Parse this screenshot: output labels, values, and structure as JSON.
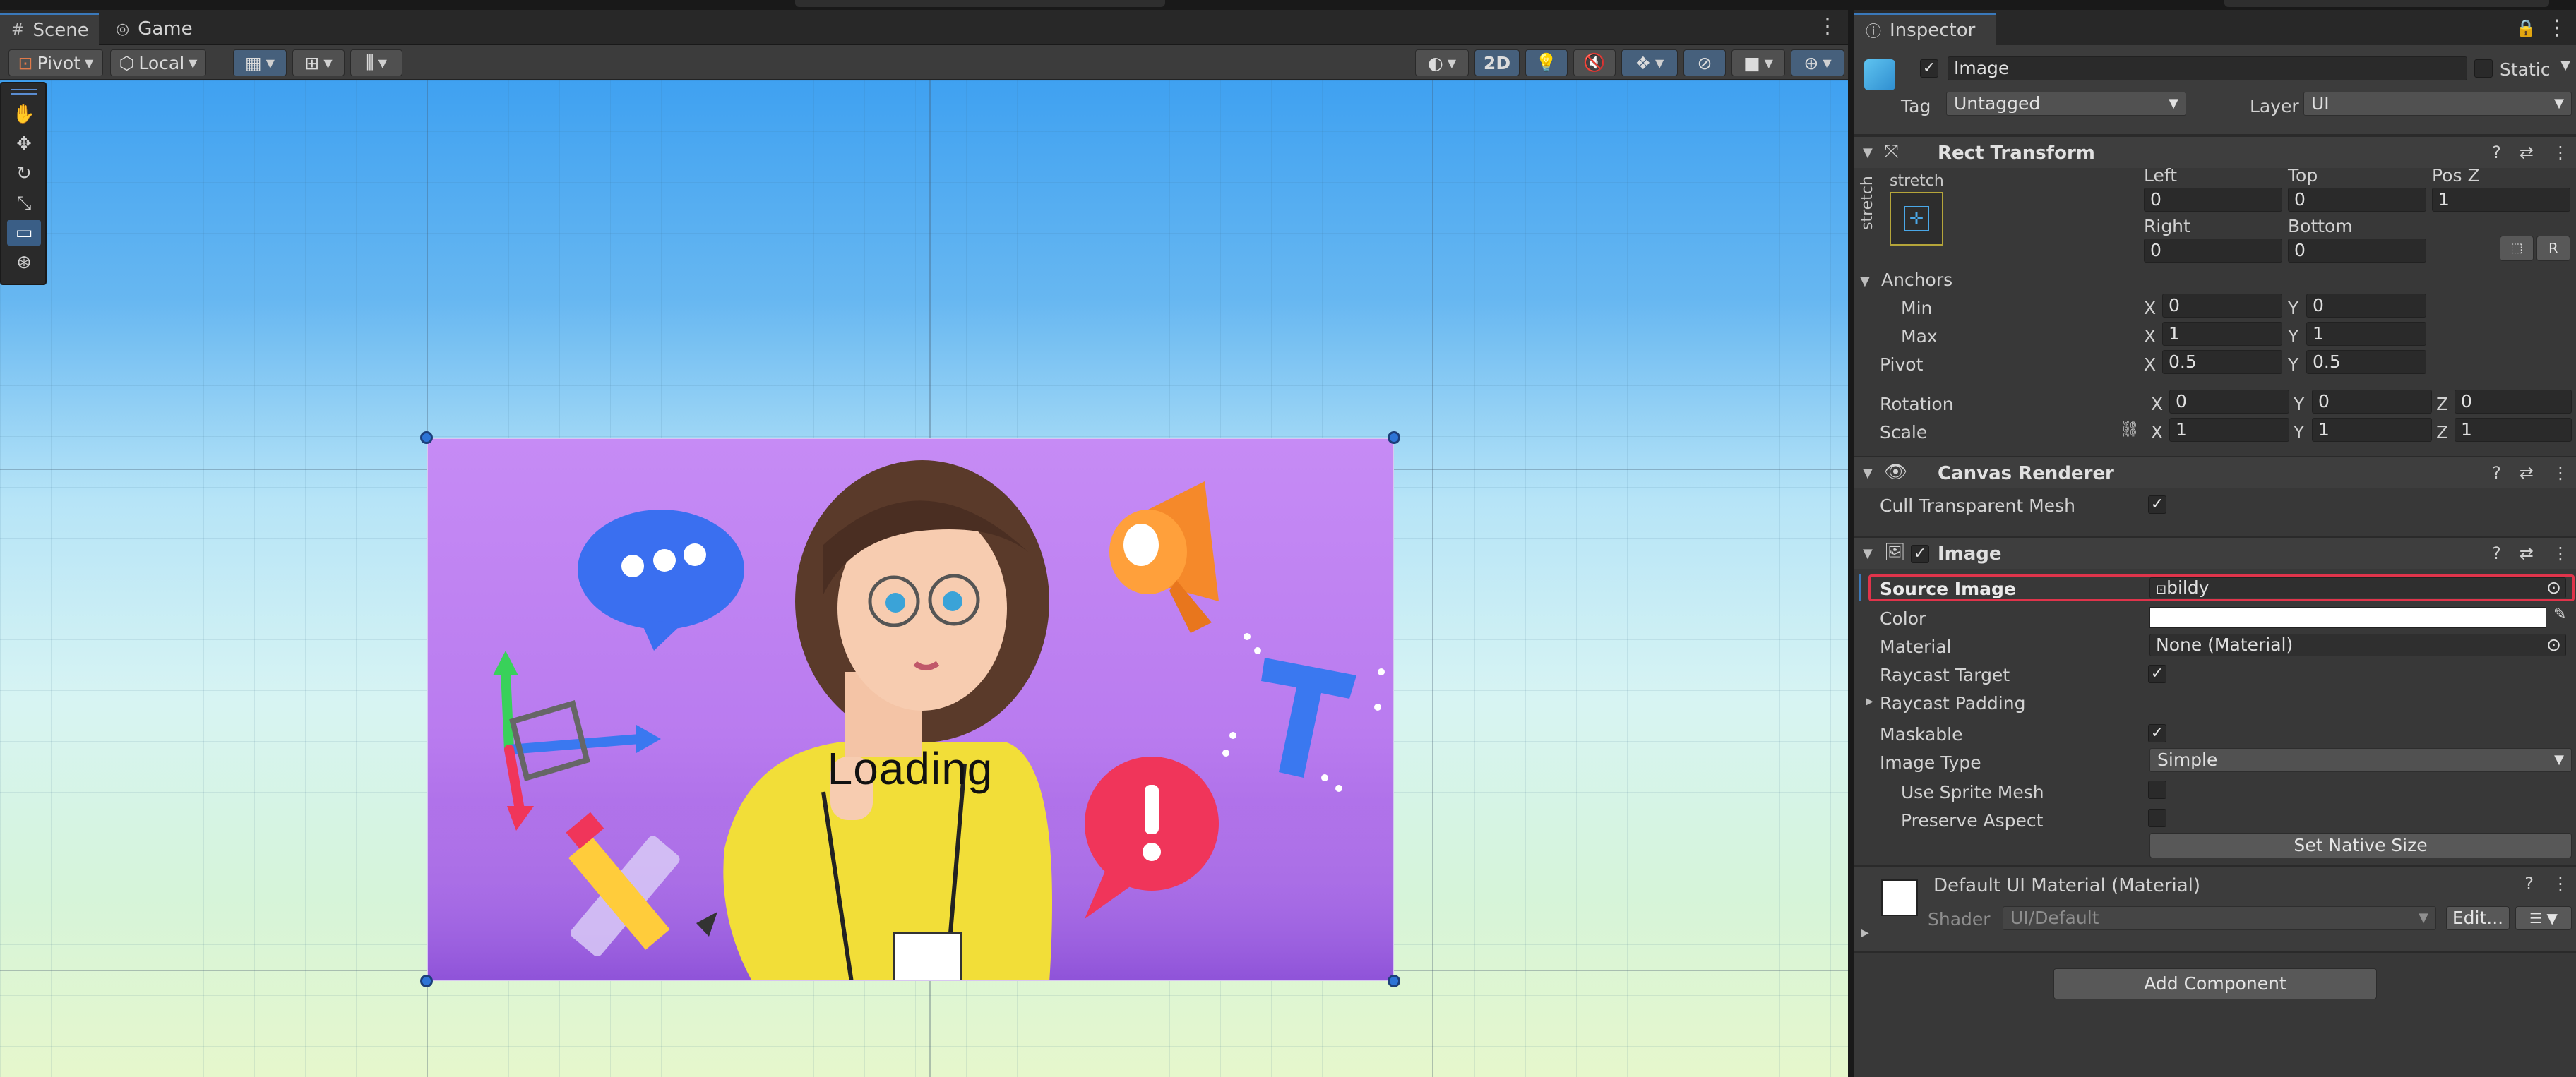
{
  "scene_panel": {
    "tabs": [
      {
        "label": "Scene",
        "icon": "grid-icon"
      },
      {
        "label": "Game",
        "icon": "gamepad-icon"
      }
    ],
    "toolbar": {
      "pivot": "Pivot",
      "local": "Local",
      "mode_2d": "2D"
    },
    "canvas_text": "Loading"
  },
  "inspector": {
    "tab_label": "Inspector",
    "object": {
      "name": "Image",
      "static_label": "Static",
      "tag_label": "Tag",
      "tag": "Untagged",
      "layer_label": "Layer",
      "layer": "UI"
    },
    "rect_transform": {
      "title": "Rect Transform",
      "preset_h": "stretch",
      "preset_v": "stretch",
      "left_label": "Left",
      "left": "0",
      "top_label": "Top",
      "top": "0",
      "posz_label": "Pos Z",
      "posz": "1",
      "right_label": "Right",
      "right": "0",
      "bottom_label": "Bottom",
      "bottom": "0",
      "r_button": "R",
      "anchors_label": "Anchors",
      "min_label": "Min",
      "min_x": "0",
      "min_y": "0",
      "max_label": "Max",
      "max_x": "1",
      "max_y": "1",
      "pivot_label": "Pivot",
      "pivot_x": "0.5",
      "pivot_y": "0.5",
      "rotation_label": "Rotation",
      "rot_x": "0",
      "rot_y": "0",
      "rot_z": "0",
      "scale_label": "Scale",
      "scale_x": "1",
      "scale_y": "1",
      "scale_z": "1",
      "x": "X",
      "y": "Y",
      "z": "Z"
    },
    "canvas_renderer": {
      "title": "Canvas Renderer",
      "cull_label": "Cull Transparent Mesh",
      "cull": true
    },
    "image": {
      "title": "Image",
      "source_label": "Source Image",
      "source": "bildy",
      "color_label": "Color",
      "color_value": "#ffffff",
      "material_label": "Material",
      "material": "None (Material)",
      "raycast_label": "Raycast Target",
      "padding_label": "Raycast Padding",
      "maskable_label": "Maskable",
      "type_label": "Image Type",
      "type": "Simple",
      "sprite_mesh_label": "Use Sprite Mesh",
      "preserve_label": "Preserve Aspect",
      "native_button": "Set Native Size"
    },
    "material_panel": {
      "title": "Default UI Material (Material)",
      "shader_label": "Shader",
      "shader": "UI/Default",
      "edit_button": "Edit..."
    },
    "add_component": "Add Component"
  },
  "colors": {
    "accent": "#3a79bb",
    "highlight": "#e0344b",
    "canvas_purple": "#b97bef"
  }
}
